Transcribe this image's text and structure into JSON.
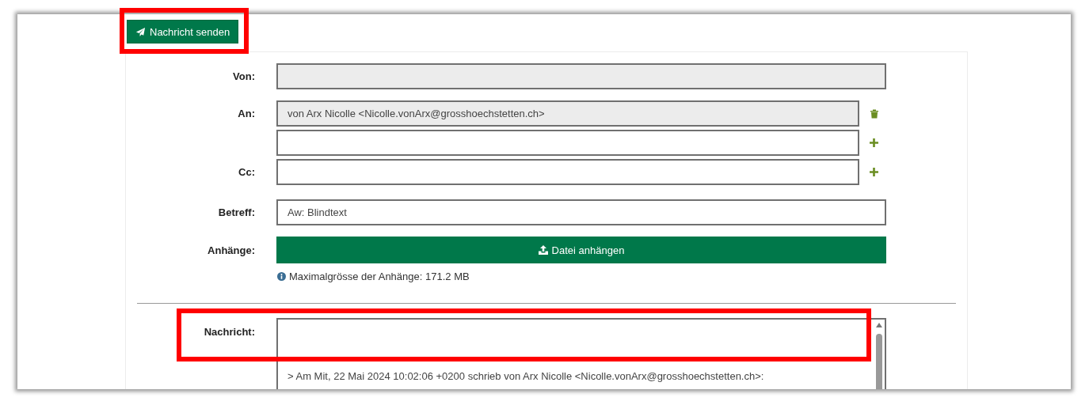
{
  "send_button": {
    "label": "Nachricht senden"
  },
  "from": {
    "label": "Von:",
    "disabled": true
  },
  "to": {
    "label": "An:",
    "rows": [
      {
        "kind": "recipient",
        "value": "von Arx Nicolle <Nicolle.vonArx@grosshoechstetten.ch>",
        "disabled": true
      },
      {
        "kind": "new",
        "disabled": false
      }
    ]
  },
  "cc": {
    "label": "Cc:",
    "rows": [
      {
        "kind": "new",
        "disabled": false
      }
    ]
  },
  "subject": {
    "label": "Betreff:",
    "value": "Aw: Blindtext"
  },
  "attachments": {
    "label": "Anhänge:",
    "button": "Datei anhängen",
    "hint": "Maximalgrösse der Anhänge: 171.2 MB"
  },
  "message": {
    "label": "Nachricht:",
    "quote": "> Am Mit, 22 Mai 2024 10:02:06 +0200 schrieb von Arx Nicolle <Nicolle.vonArx@grosshoechstetten.ch>:"
  }
}
